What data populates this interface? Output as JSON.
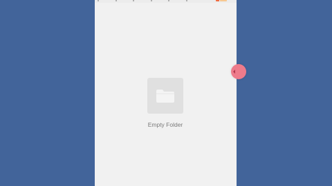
{
  "page": {
    "empty_state_label": "Empty Folder",
    "folder_icon": "folder-icon",
    "handle_icon": "chevron-left-icon"
  },
  "colors": {
    "side_background": "#42649a",
    "screen_background": "#f1f1f1",
    "status_strip": "#ececec",
    "folder_tile": "#e0e0e0",
    "folder_glyph": "#f4f4f4",
    "handle": "#ee7b8b",
    "battery_a": "#f06b40",
    "battery_b": "#f7c891"
  }
}
